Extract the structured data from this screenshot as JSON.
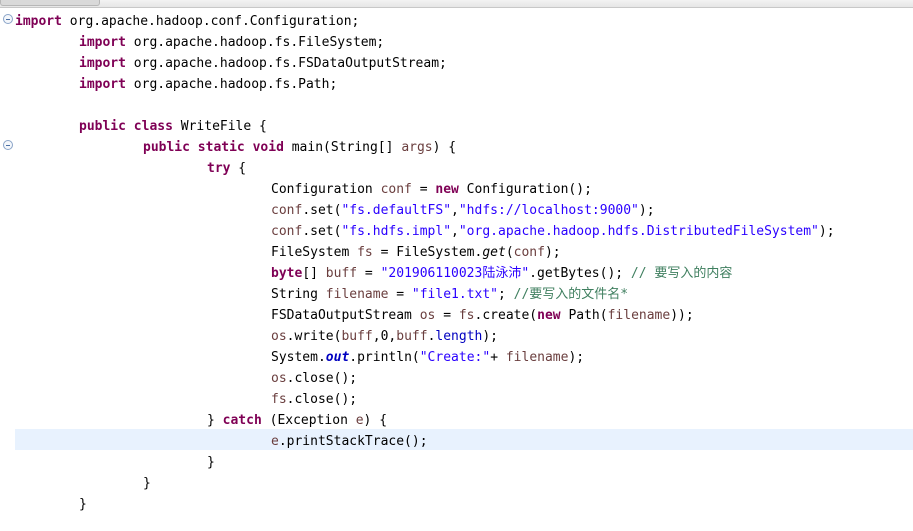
{
  "code": {
    "l1": [
      "import",
      " org.apache.hadoop.conf.Configuration;"
    ],
    "l2": [
      "import",
      " org.apache.hadoop.fs.FileSystem;"
    ],
    "l3": [
      "import",
      " org.apache.hadoop.fs.FSDataOutputStream;"
    ],
    "l4": [
      "import",
      " org.apache.hadoop.fs.Path;"
    ],
    "l6": [
      "public",
      " ",
      "class",
      " WriteFile {"
    ],
    "l7": [
      "public",
      " ",
      "static",
      " ",
      "void",
      " main(String[] ",
      "args",
      ") {"
    ],
    "l8": [
      "try",
      " {"
    ],
    "l9": [
      "Configuration ",
      "conf",
      " = ",
      "new",
      " Configuration();"
    ],
    "l10": [
      "conf",
      ".set(",
      "\"fs.defaultFS\"",
      ",",
      "\"hdfs://localhost:9000\"",
      ");"
    ],
    "l11": [
      "conf",
      ".set(",
      "\"fs.hdfs.impl\"",
      ",",
      "\"org.apache.hadoop.hdfs.DistributedFileSystem\"",
      ");"
    ],
    "l12": [
      "FileSystem ",
      "fs",
      " = FileSystem.",
      "get",
      "(",
      "conf",
      ");"
    ],
    "l13": [
      "byte",
      "[] ",
      "buff",
      " = ",
      "\"201906110023陆泳沛\"",
      ".getBytes(); ",
      "// 要写入的内容"
    ],
    "l14": [
      "String ",
      "filename",
      " = ",
      "\"file1.txt\"",
      "; ",
      "//要写入的文件名*"
    ],
    "l15": [
      "FSDataOutputStream ",
      "os",
      " = ",
      "fs",
      ".create(",
      "new",
      " Path(",
      "filename",
      "));"
    ],
    "l16": [
      "os",
      ".write(",
      "buff",
      ",0,",
      "buff",
      ".",
      "length",
      ");"
    ],
    "l17": [
      "System.",
      "out",
      ".println(",
      "\"Create:\"",
      "+ ",
      "filename",
      ");"
    ],
    "l18": [
      "os",
      ".close();"
    ],
    "l19": [
      "fs",
      ".close();"
    ],
    "l20": [
      "} ",
      "catch",
      " (Exception ",
      "e",
      ") {"
    ],
    "l21": [
      "e",
      ".printStackTrace();"
    ],
    "l22": [
      "}"
    ],
    "l23": [
      "}"
    ],
    "l24": [
      "}"
    ]
  }
}
